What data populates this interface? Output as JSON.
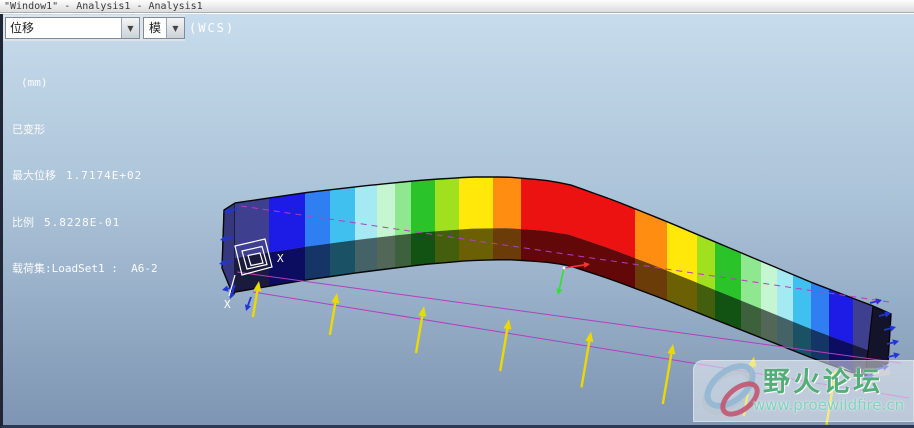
{
  "window": {
    "title": "\"Window1\" - Analysis1 - Analysis1"
  },
  "toolbar": {
    "result_type_value": "位移",
    "component_value": "模",
    "dropdown_glyph": "▼",
    "csys_label": "(WCS)"
  },
  "legend": {
    "units": "(mm)",
    "deformed_label": "已变形",
    "max_disp_label": "最大位移",
    "max_disp_value": "1.7174E+02",
    "scale_label": "比例",
    "scale_value": "5.8228E-01",
    "loadset_line": "载荷集:LoadSet1 :  A6-2"
  },
  "watermark": {
    "site_name": "野火论坛",
    "site_url": "www.proewildfire.cn"
  },
  "scene": {
    "axis_label": "X",
    "fringe_palette": [
      "#3f3f90",
      "#1c1ce6",
      "#2f7ff2",
      "#3fc0ee",
      "#a5e9f2",
      "#c6f5d2",
      "#8fe88f",
      "#2ac42a",
      "#a0e01e",
      "#ffe80a",
      "#ff8d12",
      "#ec1212"
    ],
    "end_cap_color": "#13132a",
    "under_face_color": "#a9aab2",
    "constraint_arrow_color": "#2134d6",
    "load_arrow_color": "#ecd900",
    "undeformed_line_color": "#b23fc0",
    "triad_x_color": "#ff3030",
    "triad_y_color": "#2ee22e",
    "wcs_symbol_color": "#ffffff"
  }
}
